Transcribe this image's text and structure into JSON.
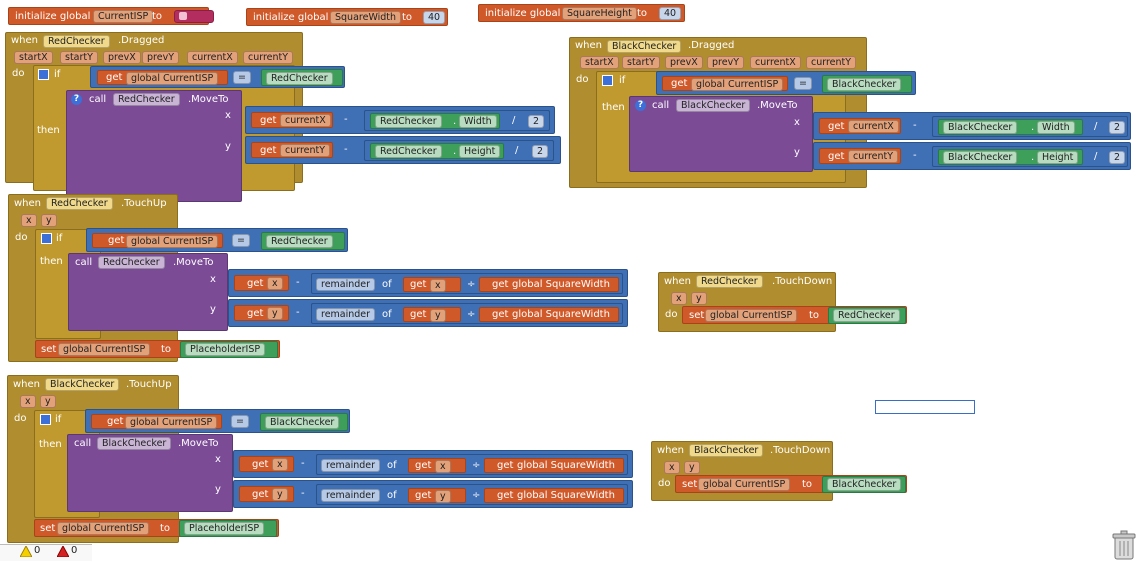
{
  "globals": [
    {
      "keyword": "initialize global",
      "name": "CurrentISP",
      "to": "to",
      "value": " "
    },
    {
      "keyword": "initialize global",
      "name": "SquareWidth",
      "to": "to",
      "value": "40"
    },
    {
      "keyword": "initialize global",
      "name": "SquareHeight",
      "to": "to",
      "value": "40"
    }
  ],
  "common": {
    "when": "when",
    "do": "do",
    "if": "if",
    "then": "then",
    "call": "call",
    "set": "set",
    "to": "to",
    "get": "get",
    "x": "x",
    "y": "y",
    "minus": "-",
    "divide": "/",
    "div": "÷",
    "eq": "=",
    "of": "of",
    "remainder": "remainder",
    "moveto": ".MoveTo",
    "width": "Width",
    "height": "Height",
    "global_current": "global CurrentISP",
    "global_sqw": "global SquareWidth",
    "placeholder": "PlaceholderISP",
    "two": "2"
  },
  "events": {
    "red_dragged": {
      "component": "RedChecker",
      "event": ".Dragged",
      "params": [
        "startX",
        "startY",
        "prevX",
        "prevY",
        "currentX",
        "currentY"
      ]
    },
    "black_dragged": {
      "component": "BlackChecker",
      "event": ".Dragged",
      "params": [
        "startX",
        "startY",
        "prevX",
        "prevY",
        "currentX",
        "currentY"
      ]
    },
    "red_touchup": {
      "component": "RedChecker",
      "event": ".TouchUp",
      "params": [
        "x",
        "y"
      ]
    },
    "black_touchup": {
      "component": "BlackChecker",
      "event": ".TouchUp",
      "params": [
        "x",
        "y"
      ]
    },
    "red_touchdown": {
      "component": "RedChecker",
      "event": ".TouchDown",
      "params": [
        "x",
        "y"
      ]
    },
    "black_touchdown": {
      "component": "BlackChecker",
      "event": ".TouchDown",
      "params": [
        "x",
        "y"
      ]
    }
  },
  "vars": {
    "currentX": "currentX",
    "currentY": "currentY"
  },
  "warnings": {
    "warnings_count": "0",
    "errors_count": "0"
  },
  "colors": {
    "event": "#b08d2e",
    "variable": "#d0592a",
    "procedure": "#7b4b96",
    "math": "#3f6fb5",
    "component": "#3d9f5a",
    "text": "#b32d5e"
  }
}
